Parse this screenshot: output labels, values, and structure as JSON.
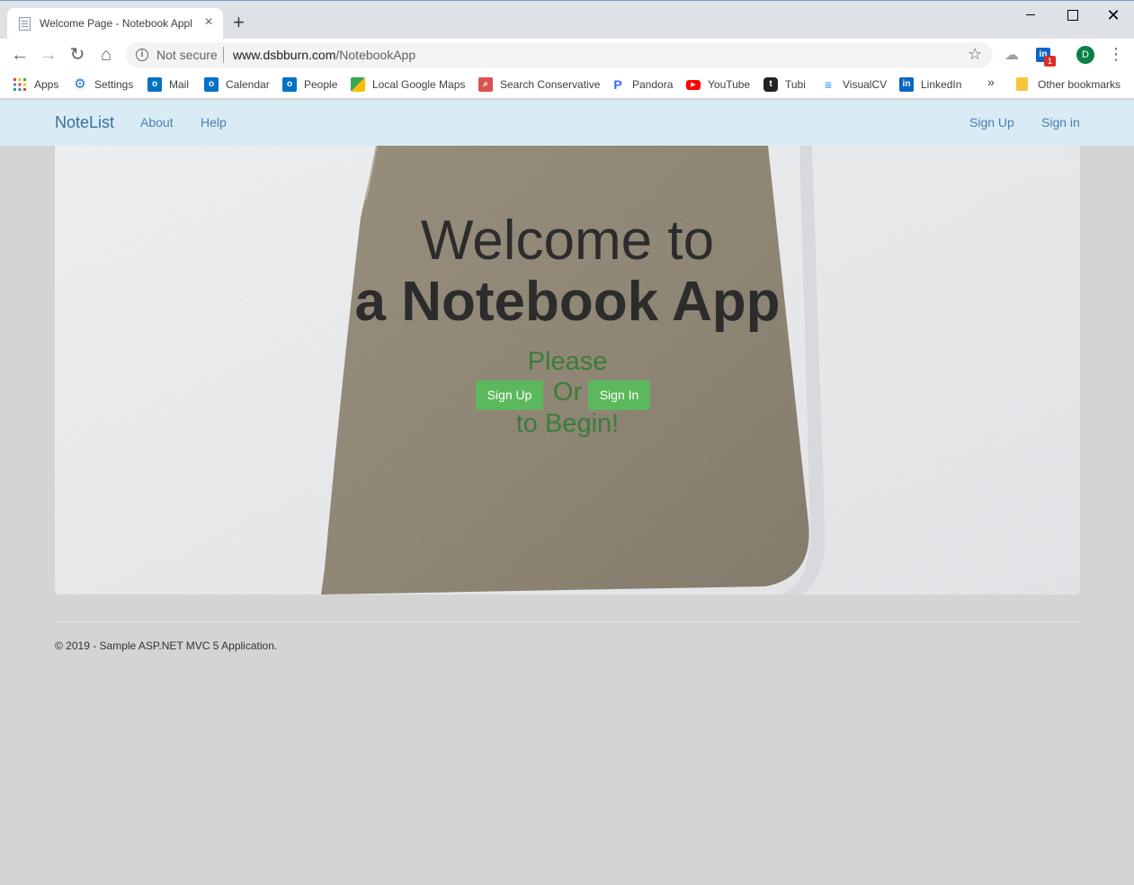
{
  "browser": {
    "tab_title": "Welcome Page - Notebook Appli",
    "not_secure": "Not secure",
    "url_domain": "www.dsbburn.com",
    "url_path": "/NotebookApp",
    "linkedin_badge": "1",
    "avatar_letter": "D",
    "bookmarks": [
      {
        "label": "Apps",
        "icon": "apps-grid-icon",
        "color": "#ea4335"
      },
      {
        "label": "Settings",
        "icon": "gear-icon",
        "color": "#1a73e8"
      },
      {
        "label": "Mail",
        "icon": "outlook-icon",
        "color": "#0072c6"
      },
      {
        "label": "Calendar",
        "icon": "outlook-icon",
        "color": "#0072c6"
      },
      {
        "label": "People",
        "icon": "outlook-icon",
        "color": "#0072c6"
      },
      {
        "label": "Local Google Maps",
        "icon": "maps-icon",
        "color": "#34a853"
      },
      {
        "label": "Search Conservative",
        "icon": "search-icon",
        "color": "#d9534f"
      },
      {
        "label": "Pandora",
        "icon": "pandora-icon",
        "color": "#3668ff"
      },
      {
        "label": "YouTube",
        "icon": "youtube-icon",
        "color": "#ff0000"
      },
      {
        "label": "Tubi",
        "icon": "tubi-icon",
        "color": "#222222"
      },
      {
        "label": "VisualCV",
        "icon": "visualcv-icon",
        "color": "#1e88e5"
      },
      {
        "label": "LinkedIn",
        "icon": "linkedin-icon",
        "color": "#0a66c2"
      }
    ],
    "bookmarks_more": "»",
    "other_bookmarks": "Other bookmarks"
  },
  "nav": {
    "brand": "NoteList",
    "about": "About",
    "help": "Help",
    "sign_up": "Sign Up",
    "sign_in": "Sign in"
  },
  "hero": {
    "line1": "Welcome to",
    "line2": "a Notebook App",
    "please": "Please",
    "or": "Or",
    "to_begin": "to Begin!",
    "sign_up_button": "Sign Up",
    "sign_in_button": "Sign In"
  },
  "footer": {
    "text": "© 2019 - Sample ASP.NET MVC 5 Application."
  },
  "colors": {
    "navbar_bg": "#d9ebf5",
    "link": "#4a7fb0",
    "button_green": "#5cb85c",
    "hero_green_text": "#3a7d3a",
    "page_bg": "#d4d4d4"
  }
}
